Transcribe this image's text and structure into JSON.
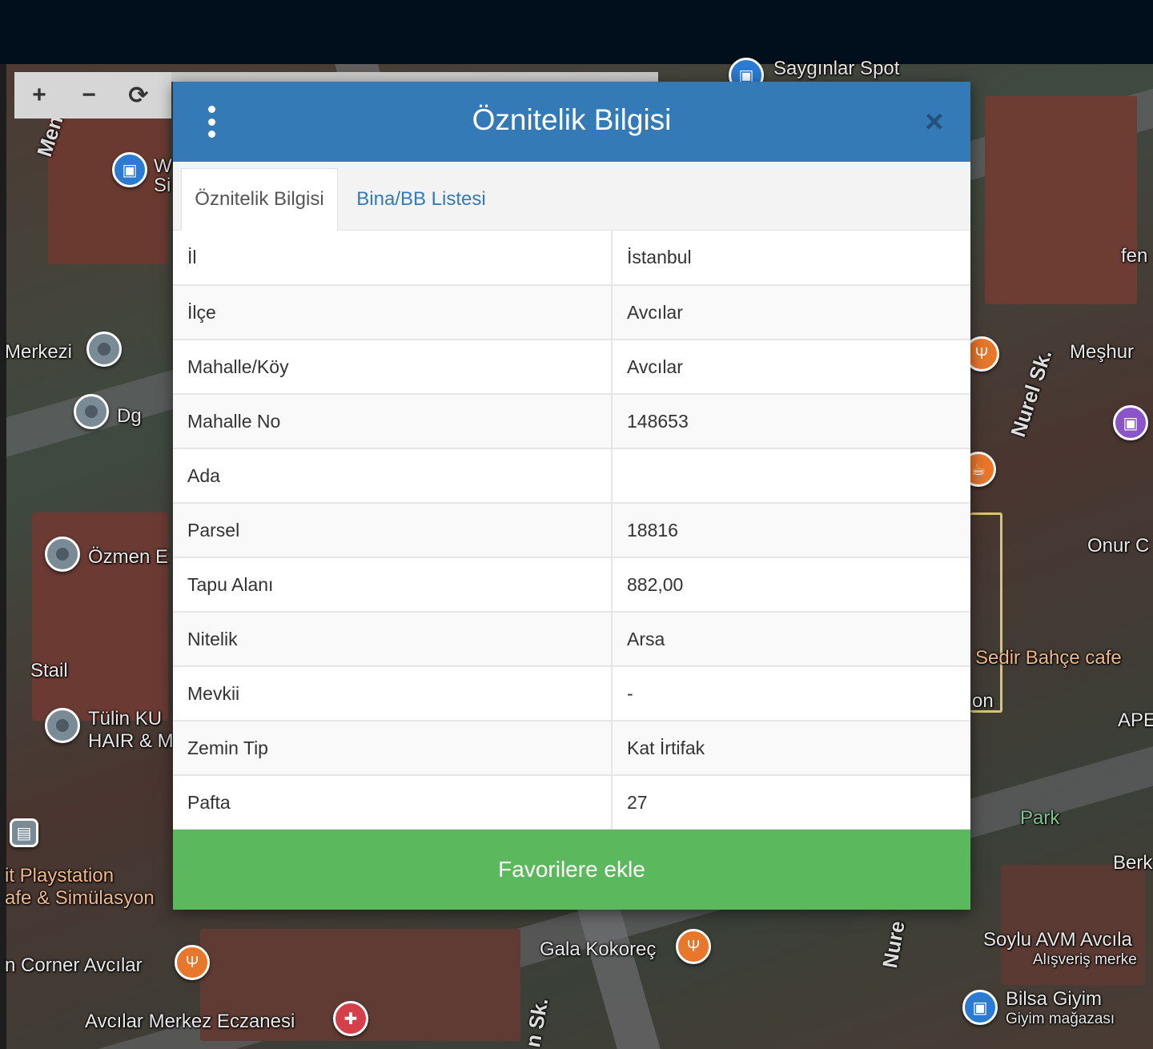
{
  "map": {
    "labels": {
      "sayginlar_spot": "Saygınlar Spot",
      "menek": "Meneks",
      "w_si": "W Si",
      "merkezi": "Merkezi",
      "dg": "Dg",
      "ozmen": "Özmen E",
      "stail": "Stail",
      "tulin": "Tülin KU",
      "hair": "HAIR & M",
      "playstation": "it Playstation",
      "simulasyon": "afe & Simülasyon",
      "corner": "n Corner Avcılar",
      "eczane": "Avcılar Merkez Eczanesi",
      "gala": "Gala Kokoreç",
      "nure_sk_bottom": "Nure",
      "sk_bottom": "n Sk.",
      "fen": "fen",
      "nurel_sk": "Nurel Sk.",
      "meshur": "Meşhur",
      "onur": "Onur C",
      "sedir": "Sedir Bahçe cafe",
      "on": "on",
      "ape": "APE",
      "park": "Park",
      "berk": "Berk",
      "soylu": "Soylu AVM Avcıla",
      "alisveris": "Alışveriş merke",
      "bilsa": "Bilsa Giyim",
      "giyim": "Giyim mağazası"
    }
  },
  "map_controls": {
    "zoom_in": "+",
    "zoom_out": "−",
    "refresh": "⟳"
  },
  "modal": {
    "title": "Öznitelik Bilgisi",
    "close": "×",
    "tabs": [
      {
        "label": "Öznitelik Bilgisi",
        "active": true
      },
      {
        "label": "Bina/BB Listesi",
        "active": false
      }
    ],
    "rows": [
      {
        "key": "İl",
        "value": "İstanbul"
      },
      {
        "key": "İlçe",
        "value": "Avcılar"
      },
      {
        "key": "Mahalle/Köy",
        "value": "Avcılar"
      },
      {
        "key": "Mahalle No",
        "value": "148653"
      },
      {
        "key": "Ada",
        "value": ""
      },
      {
        "key": "Parsel",
        "value": "18816"
      },
      {
        "key": "Tapu Alanı",
        "value": "882,00"
      },
      {
        "key": "Nitelik",
        "value": "Arsa"
      },
      {
        "key": "Mevkii",
        "value": "-"
      },
      {
        "key": "Zemin Tip",
        "value": "Kat İrtifak"
      },
      {
        "key": "Pafta",
        "value": "27"
      }
    ],
    "favorite_button": "Favorilere ekle"
  }
}
